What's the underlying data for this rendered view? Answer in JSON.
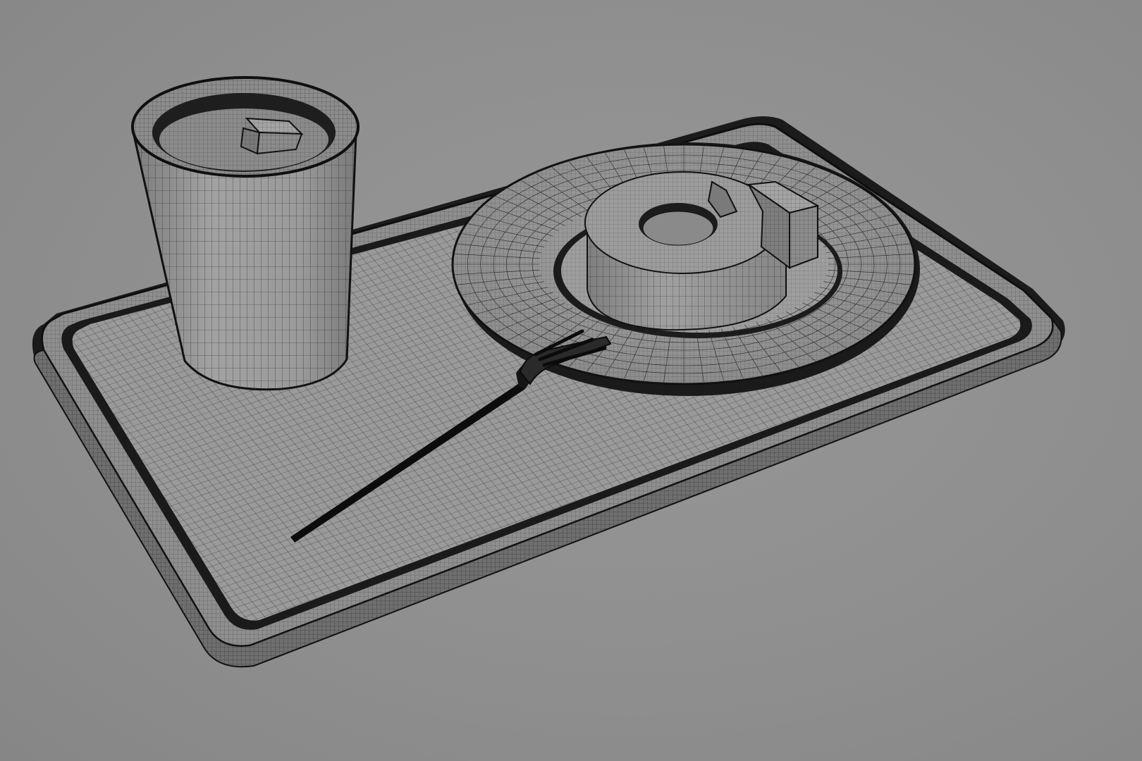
{
  "scene": {
    "objects": [
      {
        "name": "tray",
        "material": "wireframe-clay"
      },
      {
        "name": "cup",
        "material": "wireframe-clay"
      },
      {
        "name": "ice-cube",
        "material": "wireframe-clay"
      },
      {
        "name": "plate",
        "material": "wireframe-clay"
      },
      {
        "name": "ring-cake",
        "material": "wireframe-clay"
      },
      {
        "name": "cake-slice",
        "material": "wireframe-clay"
      },
      {
        "name": "fork",
        "material": "wireframe-clay"
      }
    ],
    "colors": {
      "background": "#8f8f8f",
      "surface": "#9a9a9a",
      "surface_dark": "#7c7c7c",
      "wire": "#1a1a1a",
      "wire_dense": "#0a0a0a"
    }
  }
}
